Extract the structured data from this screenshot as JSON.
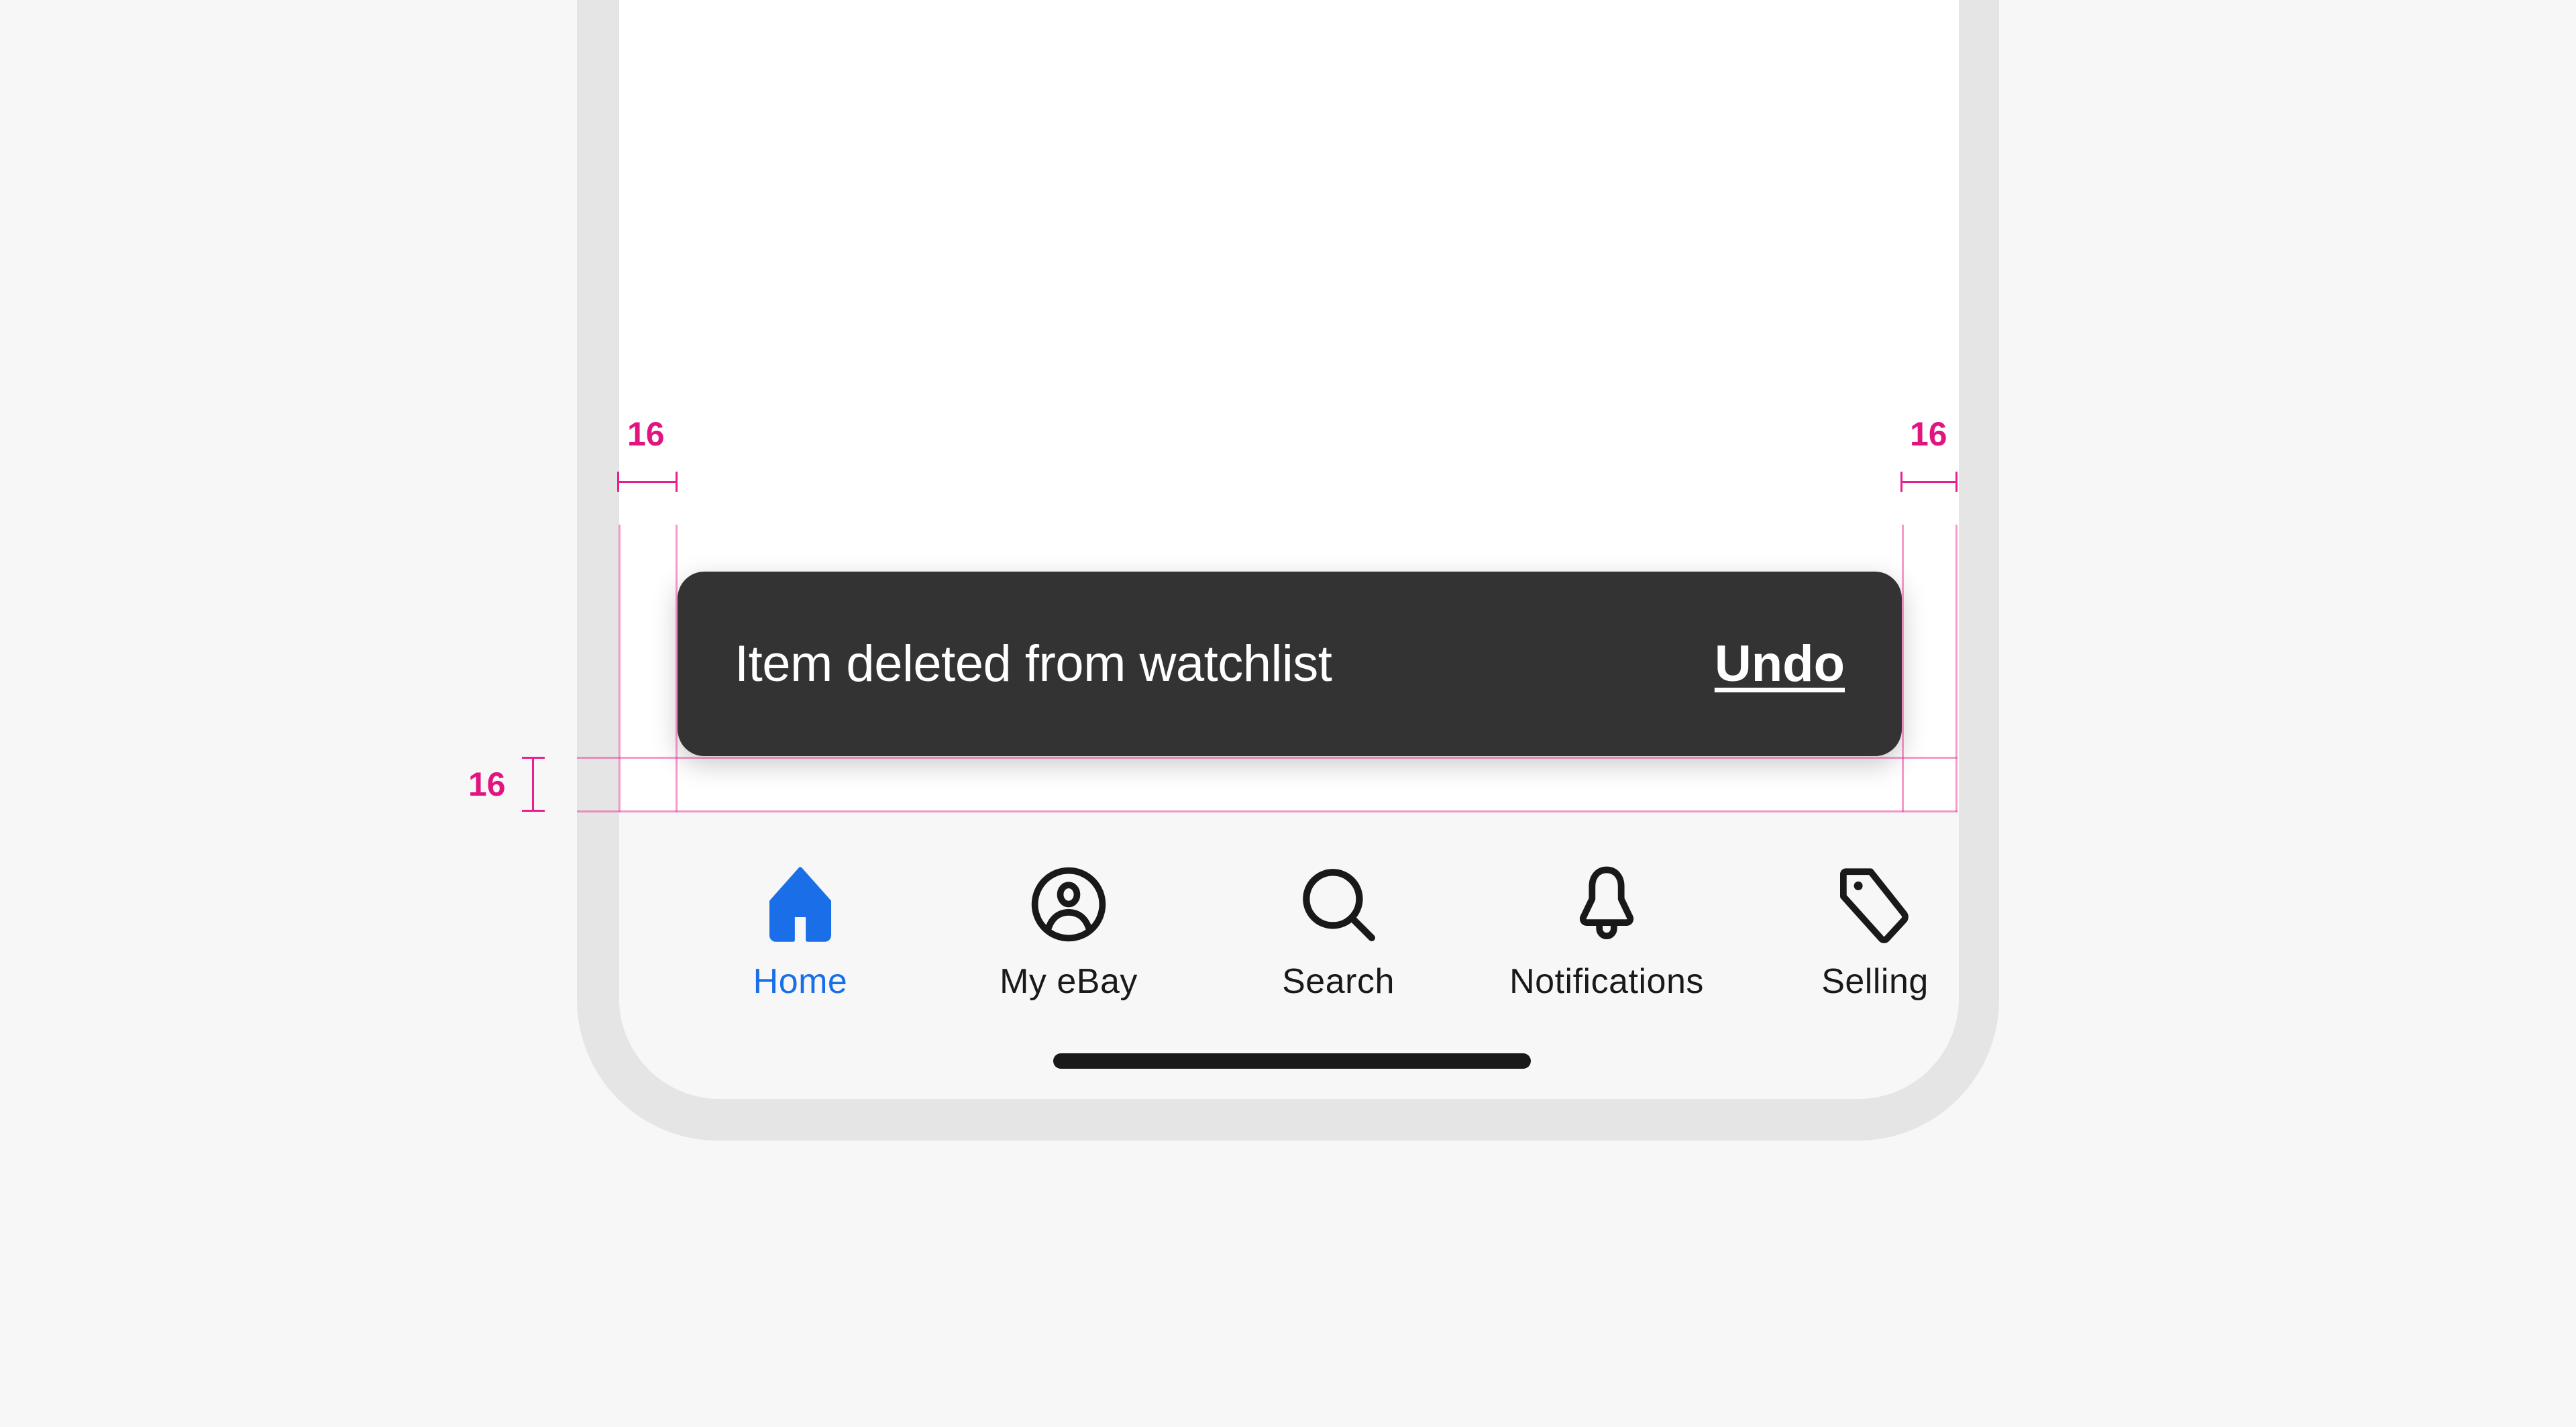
{
  "snackbar": {
    "message": "Item deleted from watchlist",
    "action_label": "Undo",
    "background_color": "#333333"
  },
  "tab_bar": {
    "active_color": "#1a6ee8",
    "items": [
      {
        "label": "Home",
        "icon": "home-icon",
        "active": true
      },
      {
        "label": "My eBay",
        "icon": "user-circle-icon",
        "active": false
      },
      {
        "label": "Search",
        "icon": "search-icon",
        "active": false
      },
      {
        "label": "Notifications",
        "icon": "bell-icon",
        "active": false
      },
      {
        "label": "Selling",
        "icon": "tag-icon",
        "active": false
      }
    ]
  },
  "annotations": {
    "color": "#e0157f",
    "left_margin": "16",
    "right_margin": "16",
    "bottom_margin": "16"
  }
}
